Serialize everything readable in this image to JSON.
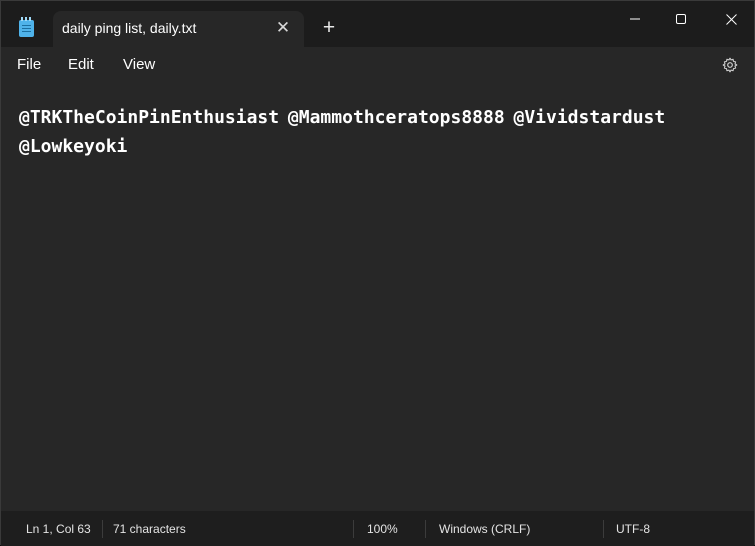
{
  "tab": {
    "title": "daily ping list, daily.txt",
    "close_icon": "close-icon",
    "new_tab_icon": "plus-icon"
  },
  "app_icon": "notepad-icon",
  "window_controls": [
    "minimize-icon",
    "maximize-icon",
    "close-icon"
  ],
  "menu": {
    "file": "File",
    "edit": "Edit",
    "view": "View",
    "settings_icon": "gear-icon"
  },
  "editor": {
    "content": "@TRKTheCoinPinEnthusiast @Mammothceratops8888 @Vividstardust\n@Lowkeyoki"
  },
  "status": {
    "position": "Ln 1, Col 63",
    "characters": "71 characters",
    "zoom": "100%",
    "line_ending": "Windows (CRLF)",
    "encoding": "UTF-8"
  },
  "colors": {
    "background": "#272727",
    "titlebar": "#1c1c1c",
    "statusbar": "#1e1e1e",
    "text": "#ffffff",
    "icon_accent": "#4fb3ea"
  }
}
